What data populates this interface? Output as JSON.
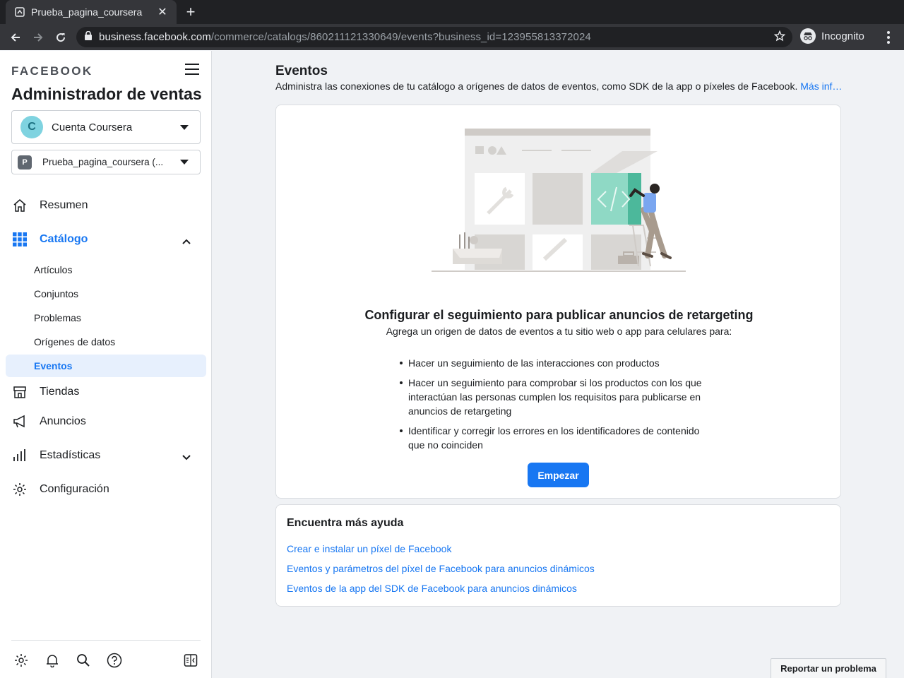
{
  "browser": {
    "tab_title": "Prueba_pagina_coursera",
    "url_host": "business.facebook.com",
    "url_path": "/commerce/catalogs/860211121330649/events?business_id=123955813372024",
    "incognito_label": "Incognito"
  },
  "sidebar": {
    "logo": "FACEBOOK",
    "app_title": "Administrador de ventas",
    "account": {
      "initial": "C",
      "name": "Cuenta Coursera",
      "avatar_color": "#7fd3e0"
    },
    "catalog": {
      "initial": "P",
      "name": "Prueba_pagina_coursera (..."
    },
    "nav": {
      "resumen": "Resumen",
      "catalogo": "Catálogo",
      "tiendas": "Tiendas",
      "anuncios": "Anuncios",
      "estadisticas": "Estadísticas",
      "configuracion": "Configuración"
    },
    "catalog_sub": [
      "Artículos",
      "Conjuntos",
      "Problemas",
      "Orígenes de datos",
      "Eventos"
    ],
    "footer_icons": [
      "gear-icon",
      "bell-icon",
      "search-icon",
      "help-icon",
      "panel-toggle-icon"
    ]
  },
  "main": {
    "title": "Eventos",
    "description": "Administra las conexiones de tu catálogo a orígenes de datos de eventos, como SDK de la app o píxeles de Facebook.",
    "more_link": "Más inf…",
    "setup": {
      "title": "Configurar el seguimiento para publicar anuncios de retargeting",
      "subtitle": "Agrega un origen de datos de eventos a tu sitio web o app para celulares para:",
      "bullets": [
        "Hacer un seguimiento de las interacciones con productos",
        "Hacer un seguimiento para comprobar si los productos con los que interactúan las personas cumplen los requisitos para publicarse en anuncios de retargeting",
        "Identificar y corregir los errores en los identificadores de contenido que no coinciden"
      ],
      "button": "Empezar"
    },
    "help": {
      "title": "Encuentra más ayuda",
      "links": [
        "Crear e instalar un píxel de Facebook",
        "Eventos y parámetros del píxel de Facebook para anuncios dinámicos",
        "Eventos de la app del SDK de Facebook para anuncios dinámicos"
      ]
    }
  },
  "report_button": "Reportar un problema",
  "colors": {
    "accent": "#1877f2",
    "background": "#f0f2f5",
    "selected_bg": "#e7f0fd"
  }
}
